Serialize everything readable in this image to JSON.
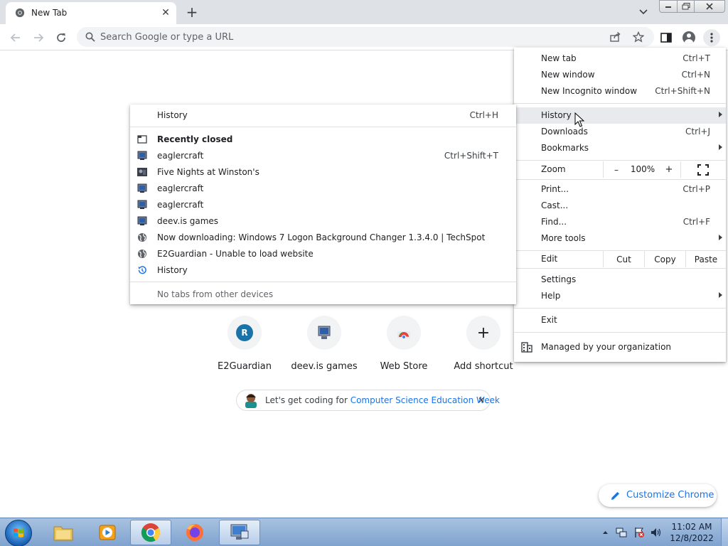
{
  "window": {
    "tab_title": "New Tab",
    "tab_close": "✕",
    "new_tab": "+"
  },
  "toolbar": {
    "omnibox_placeholder": "Search Google or type a URL"
  },
  "ntp": {
    "shortcuts": [
      {
        "label": "E2Guardian",
        "letter": "R"
      },
      {
        "label": "deev.is games"
      },
      {
        "label": "Web Store"
      },
      {
        "label": "Add shortcut",
        "symbol": "+"
      }
    ],
    "promo": {
      "text": "Let's get coding for ",
      "link": "Computer Science Education Week",
      "close": "✕"
    },
    "customize_label": "Customize Chrome"
  },
  "main_menu": {
    "new_tab": {
      "label": "New tab",
      "shortcut": "Ctrl+T"
    },
    "new_window": {
      "label": "New window",
      "shortcut": "Ctrl+N"
    },
    "new_incognito": {
      "label": "New Incognito window",
      "shortcut": "Ctrl+Shift+N"
    },
    "history": {
      "label": "History"
    },
    "downloads": {
      "label": "Downloads",
      "shortcut": "Ctrl+J"
    },
    "bookmarks": {
      "label": "Bookmarks"
    },
    "zoom": {
      "label": "Zoom",
      "minus": "–",
      "value": "100%",
      "plus": "+"
    },
    "print": {
      "label": "Print...",
      "shortcut": "Ctrl+P"
    },
    "cast": {
      "label": "Cast..."
    },
    "find": {
      "label": "Find...",
      "shortcut": "Ctrl+F"
    },
    "more_tools": {
      "label": "More tools"
    },
    "edit": {
      "label": "Edit",
      "cut": "Cut",
      "copy": "Copy",
      "paste": "Paste"
    },
    "settings": {
      "label": "Settings"
    },
    "help": {
      "label": "Help"
    },
    "exit": {
      "label": "Exit"
    },
    "managed": {
      "label": "Managed by your organization"
    }
  },
  "history_menu": {
    "history": {
      "label": "History",
      "shortcut": "Ctrl+H"
    },
    "recently_closed": "Recently closed",
    "items": [
      {
        "label": "eaglercraft",
        "shortcut": "Ctrl+Shift+T",
        "icon": "eaglercraft-icon"
      },
      {
        "label": "Five Nights at Winston's",
        "shortcut": "",
        "icon": "game-thumbnail-icon"
      },
      {
        "label": "eaglercraft",
        "shortcut": "",
        "icon": "eaglercraft-icon"
      },
      {
        "label": "eaglercraft",
        "shortcut": "",
        "icon": "eaglercraft-icon"
      },
      {
        "label": "deev.is games",
        "shortcut": "",
        "icon": "computer-icon"
      },
      {
        "label": "Now downloading: Windows 7 Logon Background Changer 1.3.4.0 | TechSpot",
        "shortcut": "",
        "icon": "globe-icon"
      },
      {
        "label": "E2Guardian - Unable to load website",
        "shortcut": "",
        "icon": "globe-icon"
      }
    ],
    "show_full_history": "History",
    "no_tabs_other_devices": "No tabs from other devices"
  },
  "taskbar": {
    "time": "11:02 AM",
    "date": "12/8/2022"
  },
  "colors": {
    "accent": "#1a73e8",
    "menu_hover": "#e8eaed",
    "tabstrip": "#dee1e6",
    "taskbar": "#8fb0d8"
  }
}
